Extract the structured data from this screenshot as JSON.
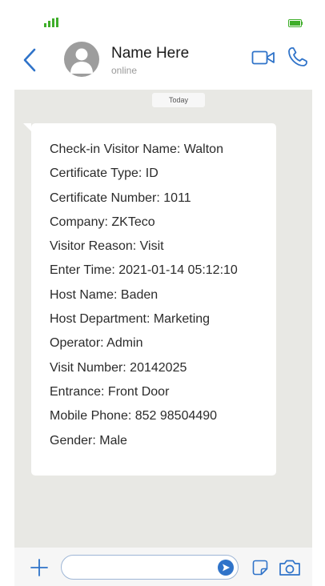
{
  "colors": {
    "accent": "#2f73c9",
    "signal": "#3fae2a",
    "chat_background": "#e8e8e4",
    "bubble": "#ffffff",
    "avatar": "#9d9d9d"
  },
  "status_bar": {
    "signal_icon": "signal-bars-icon",
    "battery_icon": "battery-icon"
  },
  "header": {
    "back_icon": "chevron-left-icon",
    "contact_name": "Name Here",
    "contact_status": "online",
    "video_icon": "video-camera-icon",
    "call_icon": "phone-icon"
  },
  "chat": {
    "date_label": "Today",
    "message_lines": [
      "Check-in Visitor Name: Walton",
      "Certificate Type: ID",
      "Certificate Number: 1011",
      "Company: ZKTeco",
      "Visitor Reason: Visit",
      "Enter Time: 2021-01-14 05:12:10",
      "Host Name: Baden",
      "Host Department: Marketing",
      "Operator: Admin",
      "Visit Number: 20142025",
      "Entrance: Front Door",
      "Mobile Phone: 852 98504490",
      "Gender: Male"
    ]
  },
  "input_bar": {
    "plus_icon": "plus-icon",
    "message_value": "",
    "send_icon": "send-icon",
    "sticker_icon": "sticker-icon",
    "camera_icon": "camera-icon"
  }
}
